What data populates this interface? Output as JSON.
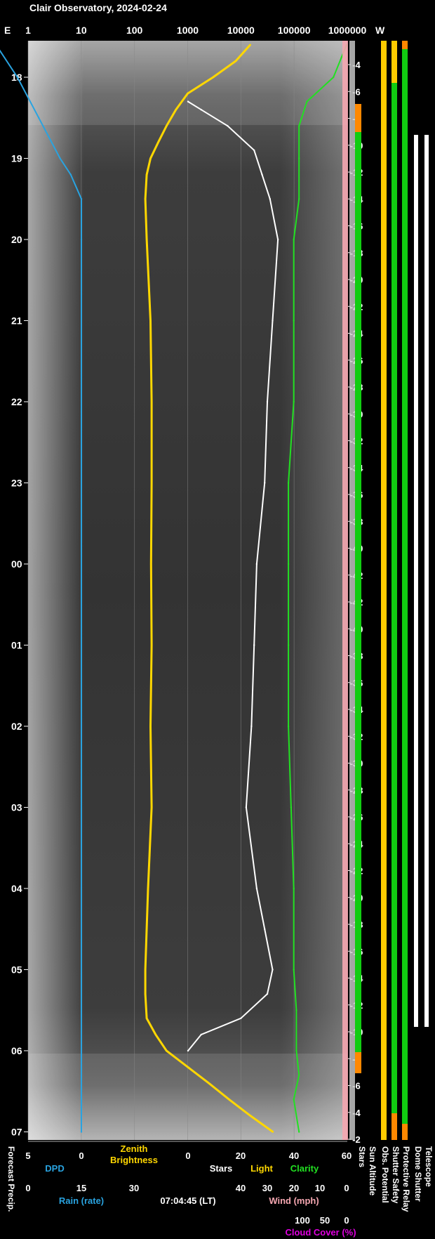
{
  "title": "Clair Observatory, 2024-02-24",
  "timestamp": "07:04:45 (LT)",
  "colors": {
    "background": "#000000",
    "sky": "#3a3a3a",
    "dpd": "#29a3e0",
    "zenith": "#ffd700",
    "stars": "#ffffff",
    "clarity": "#22e022",
    "cloud": "#e000e0",
    "wind": "#f4a6b0",
    "status_green": "#11cc11",
    "status_yellow": "#ffcc00",
    "status_orange": "#ff8800"
  },
  "chart_data": {
    "type": "line",
    "top_axis": {
      "left_label": "E",
      "right_label": "W",
      "ticks": [
        "1",
        "10",
        "100",
        "1000",
        "10000",
        "100000",
        "1000000"
      ],
      "scale": "log"
    },
    "time_axis": {
      "ticks": [
        "18",
        "19",
        "20",
        "21",
        "22",
        "23",
        "00",
        "01",
        "02",
        "03",
        "04",
        "05",
        "06",
        "07"
      ],
      "range_hours": [
        17.55,
        31.1
      ]
    },
    "sun_altitude_ticks": [
      "-4",
      "-6",
      "-8",
      "-10",
      "-12",
      "-14",
      "-16",
      "-18",
      "-20",
      "-22",
      "-24",
      "-26",
      "-28",
      "-30",
      "-32",
      "-34",
      "-36",
      "-38",
      "-40",
      "-42",
      "-42",
      "-40",
      "-38",
      "-36",
      "-34",
      "-32",
      "-30",
      "-28",
      "-26",
      "-24",
      "-22",
      "-20",
      "-18",
      "-16",
      "-14",
      "-12",
      "-10",
      "-8",
      "-6",
      "-4",
      "-2"
    ],
    "bottom_scales": {
      "dpd": {
        "label": "DPD",
        "ticks": [
          "5",
          "0"
        ]
      },
      "zenith": {
        "label_line1": "Zenith",
        "label_line2": "Brightness"
      },
      "stars_light": {
        "ticks": [
          "0",
          "20",
          "40",
          "60"
        ],
        "labels": [
          "Stars",
          "Light",
          "Clarity"
        ]
      },
      "rain": {
        "label": "Rain (rate)",
        "ticks": [
          "0",
          "15",
          "30"
        ]
      },
      "wind": {
        "label": "Wind (mph)",
        "ticks": [
          "40",
          "30",
          "20",
          "10",
          "0"
        ]
      },
      "cloud": {
        "label": "Cloud Cover (%)",
        "ticks": [
          "100",
          "50",
          "0"
        ]
      }
    },
    "status_labels": [
      "Forecast Precip.",
      "Stars",
      "Sun Altitude",
      "Obs. Potential",
      "Shutter Safety",
      "Protective Relay",
      "Dome Shutter",
      "Telescope"
    ],
    "series": [
      {
        "name": "Zenith Brightness",
        "x": [
          17.6,
          17.8,
          18.0,
          18.2,
          18.4,
          18.6,
          18.8,
          19.0,
          19.2,
          19.5,
          20.0,
          21.0,
          22.0,
          23.0,
          24.0,
          25.0,
          26.0,
          27.0,
          28.0,
          29.0,
          29.3,
          29.6,
          29.8,
          30.0,
          30.2,
          30.4,
          30.6,
          30.8,
          31.0
        ],
        "y": [
          15000,
          8000,
          3000,
          1000,
          600,
          400,
          280,
          200,
          170,
          160,
          170,
          200,
          210,
          210,
          205,
          210,
          200,
          210,
          180,
          160,
          160,
          170,
          250,
          400,
          1000,
          2500,
          6000,
          15000,
          40000
        ]
      },
      {
        "name": "Clarity",
        "x": [
          17.6,
          18.0,
          18.3,
          18.6,
          19.0,
          19.5,
          20.0,
          21.0,
          22.0,
          23.0,
          24.0,
          25.0,
          26.0,
          27.0,
          28.0,
          29.0,
          29.5,
          30.0,
          30.3,
          30.6,
          31.0
        ],
        "y": [
          60,
          55,
          45,
          42,
          42,
          42,
          40,
          40,
          40,
          38,
          38,
          38,
          38,
          39,
          40,
          40,
          41,
          41,
          42,
          40,
          42
        ]
      },
      {
        "name": "Stars",
        "x": [
          18.3,
          18.4,
          18.6,
          18.9,
          19.2,
          19.5,
          20.0,
          21.0,
          22.0,
          23.0,
          24.0,
          25.0,
          26.0,
          27.0,
          28.0,
          28.5,
          29.0,
          29.3,
          29.6,
          29.8,
          30.0
        ],
        "y": [
          0,
          5,
          15,
          25,
          28,
          31,
          34,
          32,
          30,
          29,
          26,
          25,
          24,
          22,
          26,
          29,
          32,
          30,
          20,
          5,
          0
        ]
      },
      {
        "name": "DPD",
        "x": [
          17.6,
          18.0,
          18.5,
          19.0,
          19.2,
          19.5,
          20.0,
          31.0
        ],
        "y": [
          8,
          6,
          4,
          2,
          1,
          0,
          0,
          0
        ]
      }
    ]
  }
}
